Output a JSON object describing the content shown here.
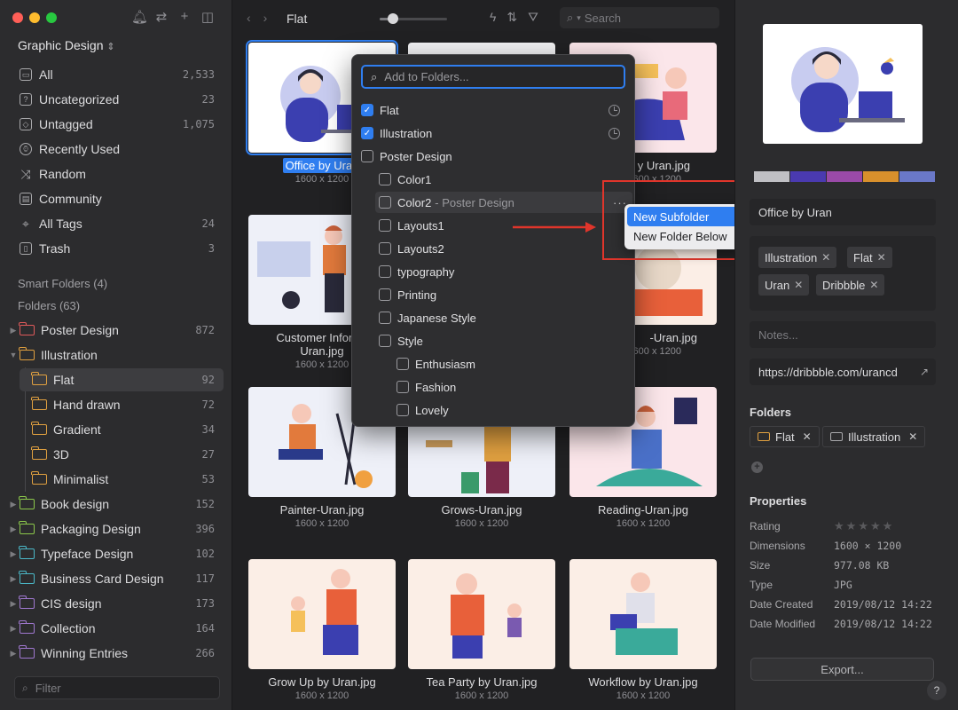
{
  "sidebar": {
    "library_name": "Graphic Design",
    "library_chevron": "⌃",
    "nav": [
      {
        "label": "All",
        "count": "2,533",
        "icon": "inbox-icon"
      },
      {
        "label": "Uncategorized",
        "count": "23",
        "icon": "question-icon"
      },
      {
        "label": "Untagged",
        "count": "1,075",
        "icon": "tag-icon"
      },
      {
        "label": "Recently Used",
        "count": "",
        "icon": "clock-icon"
      },
      {
        "label": "Random",
        "count": "",
        "icon": "shuffle-icon"
      },
      {
        "label": "Community",
        "count": "",
        "icon": "community-icon"
      },
      {
        "label": "All Tags",
        "count": "24",
        "icon": "tags-icon"
      },
      {
        "label": "Trash",
        "count": "3",
        "icon": "trash-icon"
      }
    ],
    "smart_folders_label": "Smart Folders (4)",
    "folders_label": "Folders (63)",
    "folders": [
      {
        "label": "Poster Design",
        "count": "872",
        "color": "#e05a5a"
      },
      {
        "label": "Illustration",
        "count": "",
        "color": "#e0a040"
      },
      {
        "label": "Flat",
        "count": "92",
        "color": "#e0a040"
      },
      {
        "label": "Hand drawn",
        "count": "72",
        "color": "#e0a040"
      },
      {
        "label": "Gradient",
        "count": "34",
        "color": "#e0a040"
      },
      {
        "label": "3D",
        "count": "27",
        "color": "#e0a040"
      },
      {
        "label": "Minimalist",
        "count": "53",
        "color": "#e0a040"
      },
      {
        "label": "Book design",
        "count": "152",
        "color": "#8cc84b"
      },
      {
        "label": "Packaging Design",
        "count": "396",
        "color": "#8cc84b"
      },
      {
        "label": "Typeface Design",
        "count": "102",
        "color": "#4bb8c8"
      },
      {
        "label": "Business Card Design",
        "count": "117",
        "color": "#4bb8c8"
      },
      {
        "label": "CIS design",
        "count": "173",
        "color": "#a078d0"
      },
      {
        "label": "Collection",
        "count": "164",
        "color": "#a078d0"
      },
      {
        "label": "Winning Entries",
        "count": "266",
        "color": "#a078d0"
      }
    ],
    "filter_placeholder": "Filter"
  },
  "toolbar": {
    "title": "Flat",
    "thumbnail_size_level": 0.2,
    "search_placeholder": "Search"
  },
  "grid": {
    "items": [
      {
        "name": "Office by Uran",
        "dims": "1600 x 1200"
      },
      {
        "name": "",
        "dims": ""
      },
      {
        "name": "y Uran.jpg",
        "dims": "1600 x 1200"
      },
      {
        "name": "Customer Infomat",
        "name2": "Uran.jpg",
        "dims": "1600 x 1200"
      },
      {
        "name": "",
        "dims": ""
      },
      {
        "name": "-Uran.jpg",
        "dims": "1600 x 1200"
      },
      {
        "name": "Painter-Uran.jpg",
        "dims": "1600 x 1200"
      },
      {
        "name": "Grows-Uran.jpg",
        "dims": "1600 x 1200"
      },
      {
        "name": "Reading-Uran.jpg",
        "dims": "1600 x 1200"
      },
      {
        "name": "Grow Up by Uran.jpg",
        "dims": "1600 x 1200"
      },
      {
        "name": "Tea Party by Uran.jpg",
        "dims": "1600 x 1200"
      },
      {
        "name": "Workflow by Uran.jpg",
        "dims": "1600 x 1200"
      }
    ]
  },
  "popover": {
    "search_placeholder": "Add to Folders...",
    "items": [
      {
        "label": "Flat",
        "checked": true,
        "recent": true
      },
      {
        "label": "Illustration",
        "checked": true,
        "recent": true
      },
      {
        "label": "Poster Design",
        "checked": false
      },
      {
        "label": "Color1",
        "checked": false
      },
      {
        "label": "Color2",
        "hint": "- Poster Design",
        "checked": false
      },
      {
        "label": "Layouts1",
        "checked": false
      },
      {
        "label": "Layouts2",
        "checked": false
      },
      {
        "label": "typography",
        "checked": false
      },
      {
        "label": "Printing",
        "checked": false
      },
      {
        "label": "Japanese Style",
        "checked": false
      },
      {
        "label": "Style",
        "checked": false
      },
      {
        "label": "Enthusiasm",
        "checked": false
      },
      {
        "label": "Fashion",
        "checked": false
      },
      {
        "label": "Lovely",
        "checked": false
      }
    ],
    "more_label": "···"
  },
  "context_menu": {
    "items": [
      "New Subfolder",
      "New Folder Below"
    ]
  },
  "inspector": {
    "palette": [
      "#c0c0c4",
      "#4a3ab0",
      "#9a4aa8",
      "#d8902c",
      "#6a78c8"
    ],
    "title": "Office by Uran",
    "tags": [
      "Illustration",
      "Flat",
      "Uran",
      "Dribbble"
    ],
    "notes_placeholder": "Notes...",
    "url": "https://dribbble.com/urancd",
    "folders_heading": "Folders",
    "folder_chips": [
      "Flat",
      "Illustration"
    ],
    "properties_heading": "Properties",
    "rating": 0,
    "properties": [
      {
        "key": "Rating",
        "value": ""
      },
      {
        "key": "Dimensions",
        "value": "1600 × 1200"
      },
      {
        "key": "Size",
        "value": "977.08 KB"
      },
      {
        "key": "Type",
        "value": "JPG"
      },
      {
        "key": "Date Created",
        "value": "2019/08/12 14:22"
      },
      {
        "key": "Date Modified",
        "value": "2019/08/12 14:22"
      }
    ],
    "export_label": "Export...",
    "help_label": "?"
  }
}
